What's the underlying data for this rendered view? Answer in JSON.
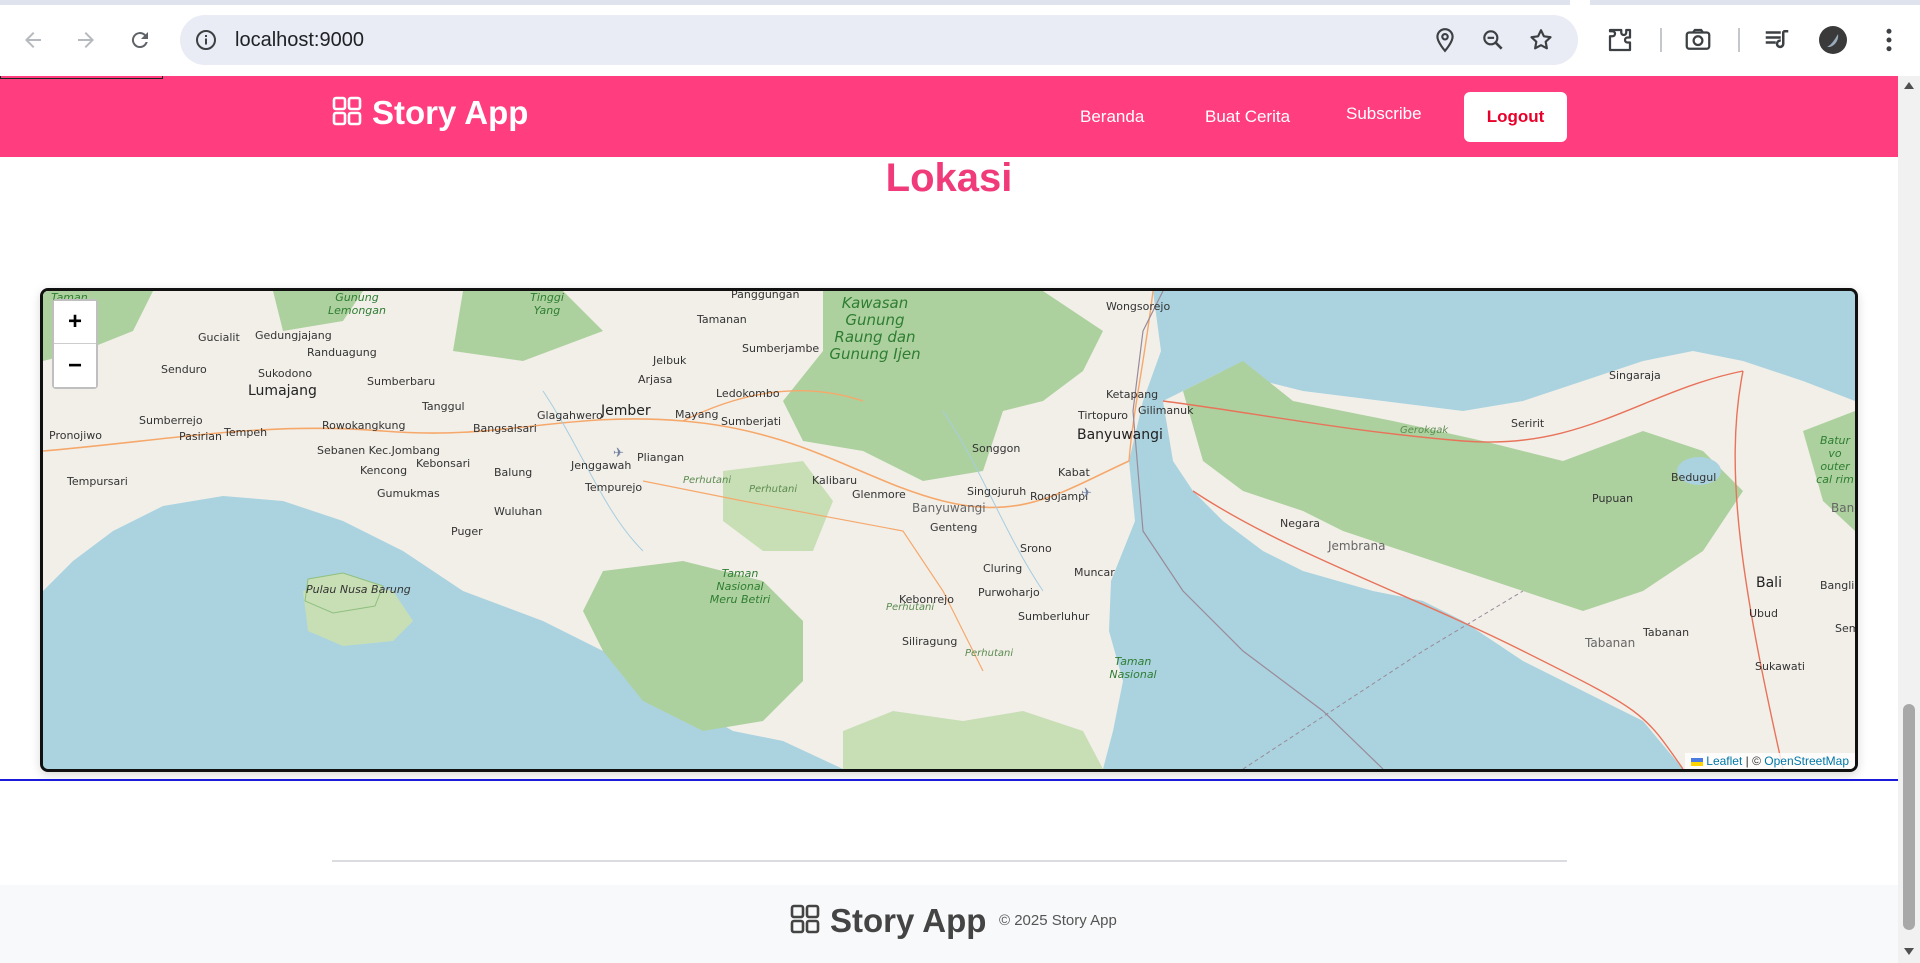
{
  "browser": {
    "url": "localhost:9000",
    "icons": [
      "back-icon",
      "forward-icon",
      "reload-icon",
      "site-info-icon",
      "location-icon",
      "zoom-icon",
      "bookmark-star-icon",
      "extensions-icon",
      "screenshot-icon",
      "media-icon",
      "profile-avatar",
      "menu-icon"
    ]
  },
  "header": {
    "brand": "Story App",
    "nav": {
      "home": "Beranda",
      "create_story": "Buat Cerita",
      "subscribe": "Subscribe",
      "logout": "Logout"
    },
    "colors": {
      "background": "#ff3d7f",
      "logout_text": "#e8002a"
    }
  },
  "section": {
    "title": "Lokasi",
    "title_color": "#f03a7a"
  },
  "map": {
    "zoom_in": "+",
    "zoom_out": "−",
    "attribution": {
      "leaflet": "Leaflet",
      "separator": " | © ",
      "osm": "OpenStreetMap"
    },
    "labels": {
      "taman": "Taman",
      "gunung_lemongan": "Gunung Lemongan",
      "tinggi_yang": "Tinggi Yang",
      "panggungan": "Panggungan",
      "kawasan": "Kawasan Gunung Raung dan Gunung Ijen",
      "wongsorejo": "Wongsorejo",
      "gucialit": "Gucialit",
      "gedungjajang": "Gedungjajang",
      "tamanan": "Tamanan",
      "randuagung": "Randuagung",
      "sumberjambe": "Sumberjambe",
      "jelbuk": "Jelbuk",
      "senduro": "Senduro",
      "sukodono": "Sukodono",
      "sumberbaru": "Sumberbaru",
      "arjasa": "Arjasa",
      "ledokombo": "Ledokombo",
      "lumajang": "Lumajang",
      "tanggul": "Tanggul",
      "jember": "Jember",
      "mayang": "Mayang",
      "glagahwero": "Glagahwero",
      "sumberjati": "Sumberjati",
      "ketapang": "Ketapang",
      "gilimanuk": "Gilimanuk",
      "tirtopuro": "Tirtopuro",
      "banyuwangi": "Banyuwangi",
      "singaraja": "Singaraja",
      "sumberrejo": "Sumberrejo",
      "rowokangkung": "Rowokangkung",
      "bangsalsari": "Bangsalsari",
      "pronojiwo": "Pronojiwo",
      "pasirian": "Pasirian",
      "tempeh": "Tempeh",
      "sebanen": "Sebanen Kec.Jombang",
      "songgon": "Songgon",
      "gerokgak": "Gerokgak",
      "seririt": "Seririt",
      "batur": "Batur vo outer cal rim",
      "kencong": "Kencong",
      "kebonsari": "Kebonsari",
      "balung": "Balung",
      "jenggawah": "Jenggawah",
      "pliangan": "Pliangan",
      "kabat": "Kabat",
      "bedugul": "Bedugul",
      "tempursari": "Tempursari",
      "perhutani1": "Perhutani",
      "kalibaru": "Kalibaru",
      "perhutani2": "Perhutani",
      "tempurejo": "Tempurejo",
      "glenmore": "Glenmore",
      "singojuruh": "Singojuruh",
      "rogojampi": "Rogojampi",
      "gumukmas": "Gumukmas",
      "banyuwangi_regency": "Banyuwangi",
      "pupuan": "Pupuan",
      "bangli": "Bangli",
      "wuluhan": "Wuluhan",
      "genteng": "Genteng",
      "negara": "Negara",
      "puger": "Puger",
      "srono": "Srono",
      "jembrana": "Jembrana",
      "taman_nasional_meru": "Taman Nasional Meru Betiri",
      "cluring": "Cluring",
      "muncar": "Muncar",
      "bali": "Bali",
      "bangli2": "Bangli",
      "pulau_nusa_barung": "Pulau Nusa Barung",
      "kebonrejo": "Kebonrejo",
      "purwoharjo": "Purwoharjo",
      "perhutani3": "Perhutani",
      "ubud": "Ubud",
      "sumberluhur": "Sumberluhur",
      "tabanan": "Tabanan",
      "sem": "Sem",
      "tabanan2": "Tabanan",
      "siliragung": "Siliragung",
      "perhutani4": "Perhutani",
      "sukawati": "Sukawati",
      "taman_nasional": "Taman Nasional"
    }
  },
  "footer": {
    "brand": "Story App",
    "copyright": "© 2025 Story App"
  }
}
